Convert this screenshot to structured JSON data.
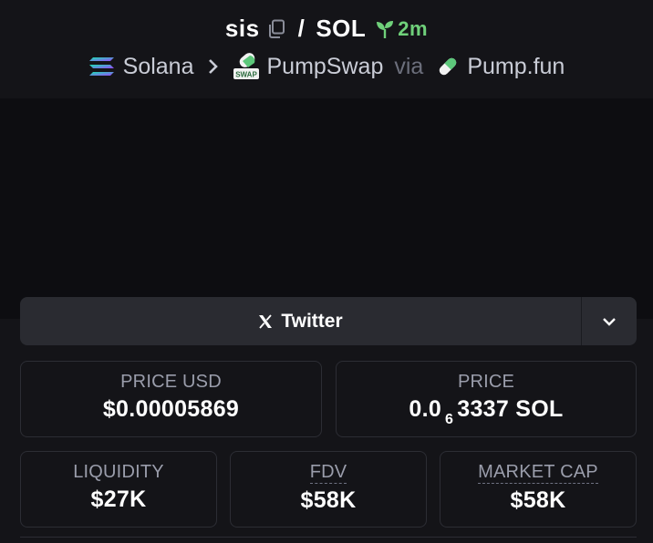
{
  "header": {
    "token_symbol": "sis",
    "separator": "/",
    "quote_symbol": "SOL",
    "age": "2m",
    "chain": "Solana",
    "dex": "PumpSwap",
    "via_label": "via",
    "launchpad": "Pump.fun",
    "dex_badge_text": "SWAP"
  },
  "socials": {
    "twitter_label": "Twitter"
  },
  "stats": {
    "price_usd_label": "PRICE USD",
    "price_usd_value": "$0.00005869",
    "price_label": "PRICE",
    "price_prefix": "0.0",
    "price_zero_count": "6",
    "price_suffix": "3337 SOL",
    "liquidity_label": "LIQUIDITY",
    "liquidity_value": "$27K",
    "fdv_label": "FDV",
    "fdv_value": "$58K",
    "mcap_label": "MARKET CAP",
    "mcap_value": "$58K"
  },
  "colors": {
    "age_green": "#6fd07a",
    "background": "#0f0f13",
    "panel": "#141418",
    "button": "#2a2b31"
  }
}
